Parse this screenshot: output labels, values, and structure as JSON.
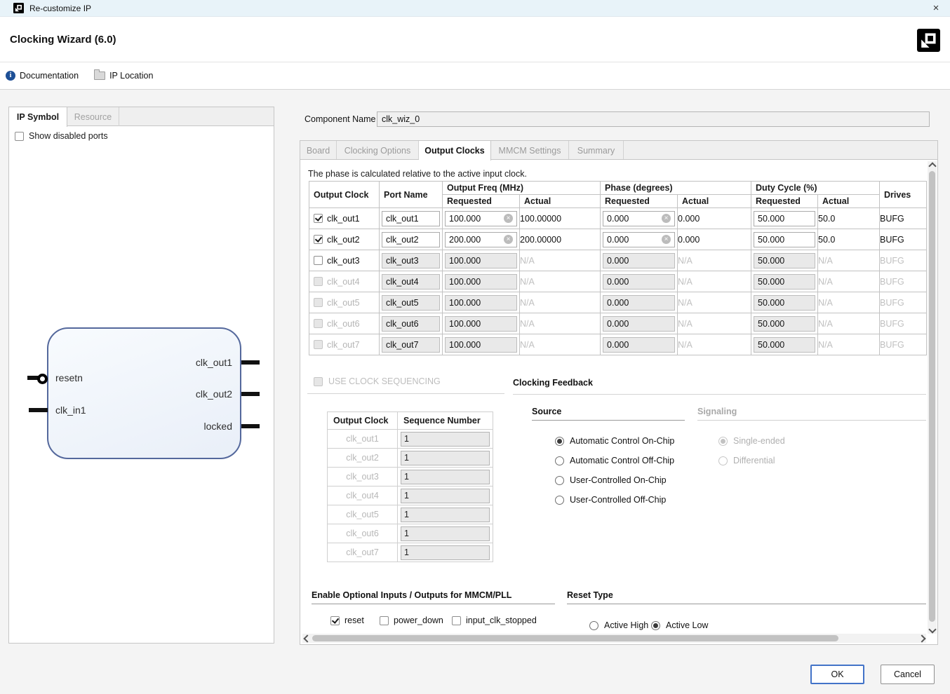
{
  "window": {
    "title": "Re-customize IP"
  },
  "header": {
    "title": "Clocking Wizard (6.0)"
  },
  "toolbar": {
    "documentation": "Documentation",
    "ip_location": "IP Location"
  },
  "left_panel": {
    "tab_ip_symbol": "IP Symbol",
    "tab_resource": "Resource",
    "show_disabled_ports": "Show disabled ports",
    "symbol": {
      "in1": "resetn",
      "in2": "clk_in1",
      "out1": "clk_out1",
      "out2": "clk_out2",
      "out3": "locked"
    }
  },
  "component": {
    "label": "Component Name",
    "value": "clk_wiz_0"
  },
  "tabs": {
    "board": "Board",
    "clocking_options": "Clocking Options",
    "output_clocks": "Output Clocks",
    "mmcm_settings": "MMCM Settings",
    "summary": "Summary"
  },
  "note": "The phase is calculated relative to the active input clock.",
  "clock_table": {
    "headers": {
      "output_clock": "Output Clock",
      "port_name": "Port Name",
      "output_freq": "Output Freq (MHz)",
      "phase": "Phase (degrees)",
      "duty_cycle": "Duty Cycle (%)",
      "requested": "Requested",
      "actual": "Actual",
      "drives": "Drives"
    },
    "rows": [
      {
        "name": "clk_out1",
        "checked": true,
        "state": "active",
        "port": "clk_out1",
        "freq_req": "100.000",
        "freq_act": "100.00000",
        "phase_req": "0.000",
        "phase_act": "0.000",
        "duty_req": "50.000",
        "duty_act": "50.0",
        "drives": "BUFG"
      },
      {
        "name": "clk_out2",
        "checked": true,
        "state": "active",
        "port": "clk_out2",
        "freq_req": "200.000",
        "freq_act": "200.00000",
        "phase_req": "0.000",
        "phase_act": "0.000",
        "duty_req": "50.000",
        "duty_act": "50.0",
        "drives": "BUFG"
      },
      {
        "name": "clk_out3",
        "checked": false,
        "state": "enabled",
        "port": "clk_out3",
        "freq_req": "100.000",
        "freq_act": "N/A",
        "phase_req": "0.000",
        "phase_act": "N/A",
        "duty_req": "50.000",
        "duty_act": "N/A",
        "drives": "BUFG"
      },
      {
        "name": "clk_out4",
        "checked": false,
        "state": "disabled",
        "port": "clk_out4",
        "freq_req": "100.000",
        "freq_act": "N/A",
        "phase_req": "0.000",
        "phase_act": "N/A",
        "duty_req": "50.000",
        "duty_act": "N/A",
        "drives": "BUFG"
      },
      {
        "name": "clk_out5",
        "checked": false,
        "state": "disabled",
        "port": "clk_out5",
        "freq_req": "100.000",
        "freq_act": "N/A",
        "phase_req": "0.000",
        "phase_act": "N/A",
        "duty_req": "50.000",
        "duty_act": "N/A",
        "drives": "BUFG"
      },
      {
        "name": "clk_out6",
        "checked": false,
        "state": "disabled",
        "port": "clk_out6",
        "freq_req": "100.000",
        "freq_act": "N/A",
        "phase_req": "0.000",
        "phase_act": "N/A",
        "duty_req": "50.000",
        "duty_act": "N/A",
        "drives": "BUFG"
      },
      {
        "name": "clk_out7",
        "checked": false,
        "state": "disabled",
        "port": "clk_out7",
        "freq_req": "100.000",
        "freq_act": "N/A",
        "phase_req": "0.000",
        "phase_act": "N/A",
        "duty_req": "50.000",
        "duty_act": "N/A",
        "drives": "BUFG"
      }
    ]
  },
  "sequencing": {
    "checkbox_label": "USE CLOCK SEQUENCING",
    "checkbox_checked": false,
    "col_output_clock": "Output Clock",
    "col_sequence_number": "Sequence Number",
    "rows": [
      {
        "clock": "clk_out1",
        "seq": "1"
      },
      {
        "clock": "clk_out2",
        "seq": "1"
      },
      {
        "clock": "clk_out3",
        "seq": "1"
      },
      {
        "clock": "clk_out4",
        "seq": "1"
      },
      {
        "clock": "clk_out5",
        "seq": "1"
      },
      {
        "clock": "clk_out6",
        "seq": "1"
      },
      {
        "clock": "clk_out7",
        "seq": "1"
      }
    ]
  },
  "feedback": {
    "title": "Clocking Feedback",
    "source_label": "Source",
    "signaling_label": "Signaling",
    "source_options": [
      {
        "label": "Automatic Control On-Chip",
        "selected": true
      },
      {
        "label": "Automatic Control Off-Chip",
        "selected": false
      },
      {
        "label": "User-Controlled On-Chip",
        "selected": false
      },
      {
        "label": "User-Controlled Off-Chip",
        "selected": false
      }
    ],
    "signaling_options": [
      {
        "label": "Single-ended",
        "selected": true
      },
      {
        "label": "Differential",
        "selected": false
      }
    ]
  },
  "optional_io": {
    "title": "Enable Optional Inputs / Outputs for MMCM/PLL",
    "options": [
      {
        "label": "reset",
        "checked": true
      },
      {
        "label": "power_down",
        "checked": false
      },
      {
        "label": "input_clk_stopped",
        "checked": false
      }
    ]
  },
  "reset_type": {
    "title": "Reset Type",
    "options": [
      {
        "label": "Active High",
        "selected": false
      },
      {
        "label": "Active Low",
        "selected": true
      }
    ]
  },
  "footer": {
    "ok": "OK",
    "cancel": "Cancel"
  }
}
